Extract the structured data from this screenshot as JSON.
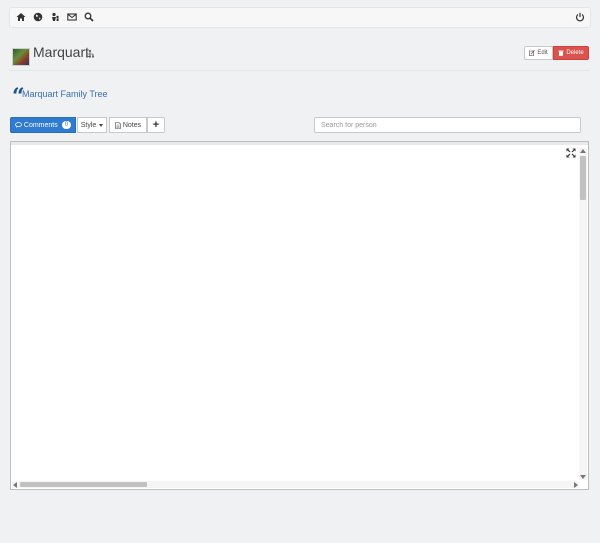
{
  "navbar": {
    "icons": [
      "home-icon",
      "globe-icon",
      "tree-icon",
      "mail-icon",
      "search-icon",
      "power-icon"
    ]
  },
  "header": {
    "title": "Marquart",
    "title_icon": "sitemap-icon",
    "edit_label": "Edit",
    "delete_label": "Delete"
  },
  "description": {
    "text": "Marquart Family Tree"
  },
  "toolbar": {
    "comments_label": "Comments",
    "comments_count": "0",
    "style_label": "Style",
    "notes_label": "Notes",
    "add_label": "+",
    "search_placeholder": "Search for person"
  },
  "colors": {
    "primary": "#2e7bcf",
    "danger": "#d9534f",
    "link": "#3b6fb0",
    "quote": "#1d4f91"
  }
}
